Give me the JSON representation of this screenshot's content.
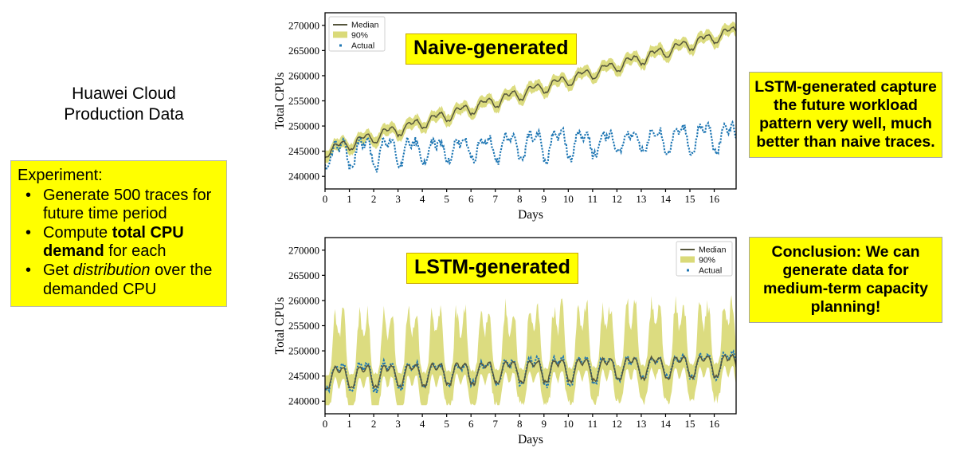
{
  "left": {
    "dataset_title_line1": "Huawei Cloud",
    "dataset_title_line2": "Production Data",
    "experiment": {
      "heading": "Experiment:",
      "bullet_glyph": "•",
      "items": [
        {
          "text_plain_1": "Generate 500 traces for future time period"
        },
        {
          "pre": "Compute ",
          "bold": "total CPU demand",
          "post": " for each"
        },
        {
          "pre": "Get ",
          "italic": "distribution",
          "post": " over the demanded CPU"
        }
      ]
    }
  },
  "callouts": {
    "lstm_quality": "LSTM-generated capture the future workload pattern very well, much better than naive traces.",
    "conclusion": "Conclusion: We can generate data for medium-term capacity planning!"
  },
  "colors": {
    "highlight_yellow": "#ffff00",
    "band_khaki": "#dada79",
    "median_olive": "#55553c",
    "actual_blue": "#1f77b4",
    "axis_black": "#000000"
  },
  "chart_data": [
    {
      "id": "naive",
      "type": "line",
      "title": "Naive-generated",
      "xlabel": "Days",
      "ylabel": "Total CPUs",
      "xlim": [
        0,
        16.9
      ],
      "ylim": [
        237500,
        272500
      ],
      "xticks": [
        0,
        1,
        2,
        3,
        4,
        5,
        6,
        7,
        8,
        9,
        10,
        11,
        12,
        13,
        14,
        15,
        16
      ],
      "yticks": [
        240000,
        245000,
        250000,
        255000,
        260000,
        265000,
        270000
      ],
      "grid": false,
      "legend_position": "upper-left",
      "legend": [
        {
          "label": "Median",
          "style": "line",
          "color": "#55553c"
        },
        {
          "label": "90%",
          "style": "band",
          "color": "#dada79"
        },
        {
          "label": "Actual",
          "style": "dot",
          "color": "#1f77b4"
        }
      ],
      "series": [
        {
          "name": "Median",
          "description": "Naive median rises steadily from ~245000 to ~269000 with daily sawtooth of ~2000 CPUs",
          "trend_start": 244800,
          "trend_end": 268800,
          "daily_amplitude": 2100,
          "points_per_day": 24
        },
        {
          "name": "90%",
          "description": "Narrow 90% band, roughly +/- 1200 CPUs around the naive median",
          "half_width": 1200
        },
        {
          "name": "Actual",
          "description": "Actual total CPUs oscillate 239500-253500 with a flat-to-slightly-rising weekly pattern",
          "baseline_start": 244000,
          "baseline_end": 247500,
          "low": 239500,
          "high": 253500
        }
      ]
    },
    {
      "id": "lstm",
      "type": "line",
      "title": "LSTM-generated",
      "xlabel": "Days",
      "ylabel": "Total CPUs",
      "xlim": [
        0,
        16.9
      ],
      "ylim": [
        237500,
        272500
      ],
      "xticks": [
        0,
        1,
        2,
        3,
        4,
        5,
        6,
        7,
        8,
        9,
        10,
        11,
        12,
        13,
        14,
        15,
        16
      ],
      "yticks": [
        240000,
        245000,
        250000,
        255000,
        260000,
        265000,
        270000
      ],
      "grid": false,
      "legend_position": "upper-right",
      "legend": [
        {
          "label": "Median",
          "style": "line",
          "color": "#55553c"
        },
        {
          "label": "90%",
          "style": "band",
          "color": "#dada79"
        },
        {
          "label": "Actual",
          "style": "dot",
          "color": "#1f77b4"
        }
      ],
      "series": [
        {
          "name": "Median",
          "description": "LSTM median closely tracks the actual trace, oscillating 242500-251500 daily",
          "baseline_start": 244500,
          "baseline_end": 247000,
          "daily_amplitude": 4200,
          "points_per_day": 24
        },
        {
          "name": "90%",
          "description": "Wide 90% band spanning roughly 239500 up to 261500, widest at daily peaks",
          "upper_peak": 261500,
          "lower_floor": 239200
        },
        {
          "name": "Actual",
          "description": "Actual total CPUs oscillate 240000-252500, well inside the LSTM 90% band",
          "low": 240000,
          "high": 252500
        }
      ]
    }
  ]
}
